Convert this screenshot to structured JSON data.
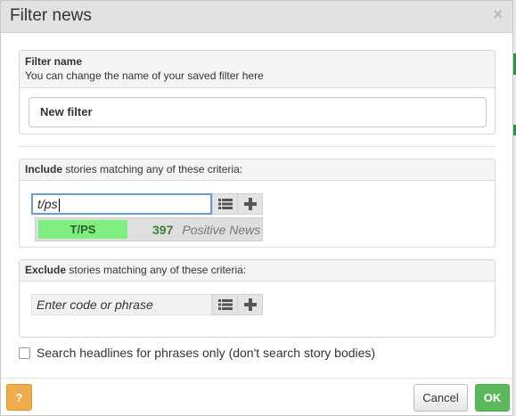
{
  "dialog": {
    "title": "Filter news",
    "close_glyph": "×"
  },
  "filter_name": {
    "heading": "Filter name",
    "hint": "You can change the name of your saved filter here",
    "value": "New filter"
  },
  "include": {
    "heading_bold": "Include",
    "heading_rest": " stories matching any of these criteria:",
    "input_value": "t/ps",
    "suggestion": {
      "code": "T/PS",
      "count": "397",
      "description": "Positive News"
    }
  },
  "exclude": {
    "heading_bold": "Exclude",
    "heading_rest": " stories matching any of these criteria:",
    "placeholder": "Enter code or phrase"
  },
  "options": {
    "headlines_only_label": "Search headlines for phrases only (don't search story bodies)",
    "headlines_only_checked": false
  },
  "footer": {
    "help_label": "?",
    "cancel_label": "Cancel",
    "ok_label": "OK"
  },
  "icons": {
    "list": "list-icon",
    "add": "plus-icon",
    "close": "close-icon"
  },
  "colors": {
    "ok": "#5cb85c",
    "help": "#f0ad4e",
    "suggest_code_bg": "#7ff07f",
    "focus": "#6b9bd8"
  }
}
